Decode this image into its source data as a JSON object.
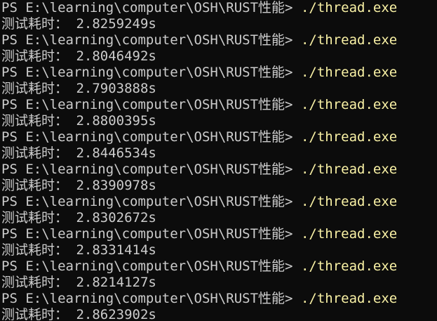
{
  "terminal": {
    "prompt": "PS E:\\learning\\computer\\OSH\\RUST性能> ",
    "command": "./thread.exe",
    "output_label": "测试耗时： ",
    "colors": {
      "background": "#0c0c0c",
      "text": "#cccccc",
      "command": "#f9f1a5"
    },
    "runs": [
      {
        "time": "2.8259249s"
      },
      {
        "time": "2.8046492s"
      },
      {
        "time": "2.7903888s"
      },
      {
        "time": "2.8800395s"
      },
      {
        "time": "2.8446534s"
      },
      {
        "time": "2.8390978s"
      },
      {
        "time": "2.8302672s"
      },
      {
        "time": "2.8331414s"
      },
      {
        "time": "2.8214127s"
      },
      {
        "time": "2.8623902s"
      }
    ]
  }
}
